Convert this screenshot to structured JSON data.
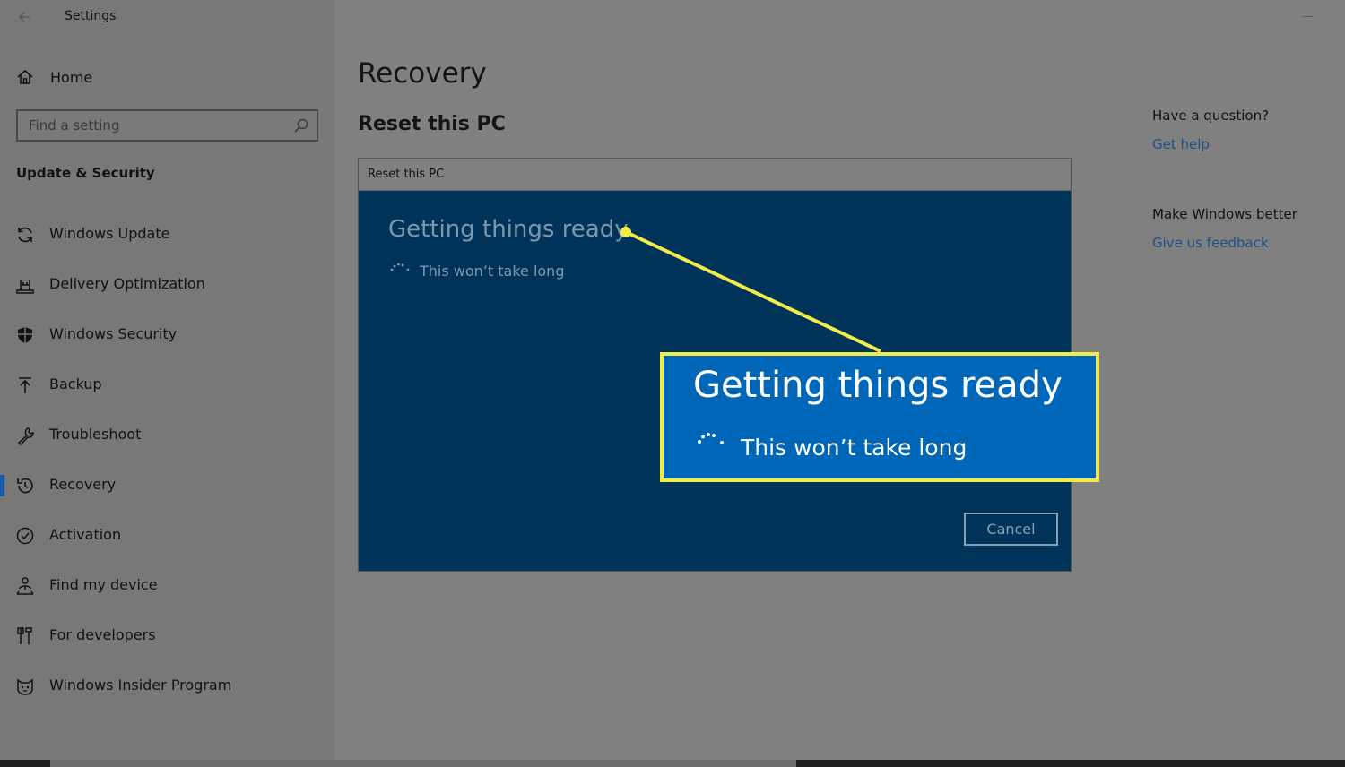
{
  "window": {
    "title": "Settings"
  },
  "sidebar": {
    "home_label": "Home",
    "search_placeholder": "Find a setting",
    "section_title": "Update & Security",
    "items": [
      {
        "label": "Windows Update",
        "icon": "sync-icon"
      },
      {
        "label": "Delivery Optimization",
        "icon": "delivery-icon"
      },
      {
        "label": "Windows Security",
        "icon": "shield-icon"
      },
      {
        "label": "Backup",
        "icon": "backup-arrow-icon"
      },
      {
        "label": "Troubleshoot",
        "icon": "wrench-icon"
      },
      {
        "label": "Recovery",
        "icon": "history-icon",
        "active": true
      },
      {
        "label": "Activation",
        "icon": "check-circle-icon"
      },
      {
        "label": "Find my device",
        "icon": "person-location-icon"
      },
      {
        "label": "For developers",
        "icon": "developer-tools-icon"
      },
      {
        "label": "Windows Insider Program",
        "icon": "insider-cat-icon"
      }
    ]
  },
  "main": {
    "title": "Recovery",
    "subtitle": "Reset this PC"
  },
  "dialog": {
    "title": "Reset this PC",
    "heading": "Getting things ready",
    "subtext": "This won’t take long",
    "cancel_label": "Cancel"
  },
  "callout": {
    "heading": "Getting things ready",
    "subtext": "This won’t take long",
    "border_color": "#f2ec4a",
    "background_color": "#0067b8"
  },
  "right_panel": {
    "question": "Have a question?",
    "help_link": "Get help",
    "improve": "Make Windows better",
    "feedback_link": "Give us feedback"
  },
  "colors": {
    "accent": "#1a5aa8",
    "link": "#1f4f86",
    "dialog_bg": "#00335a"
  }
}
